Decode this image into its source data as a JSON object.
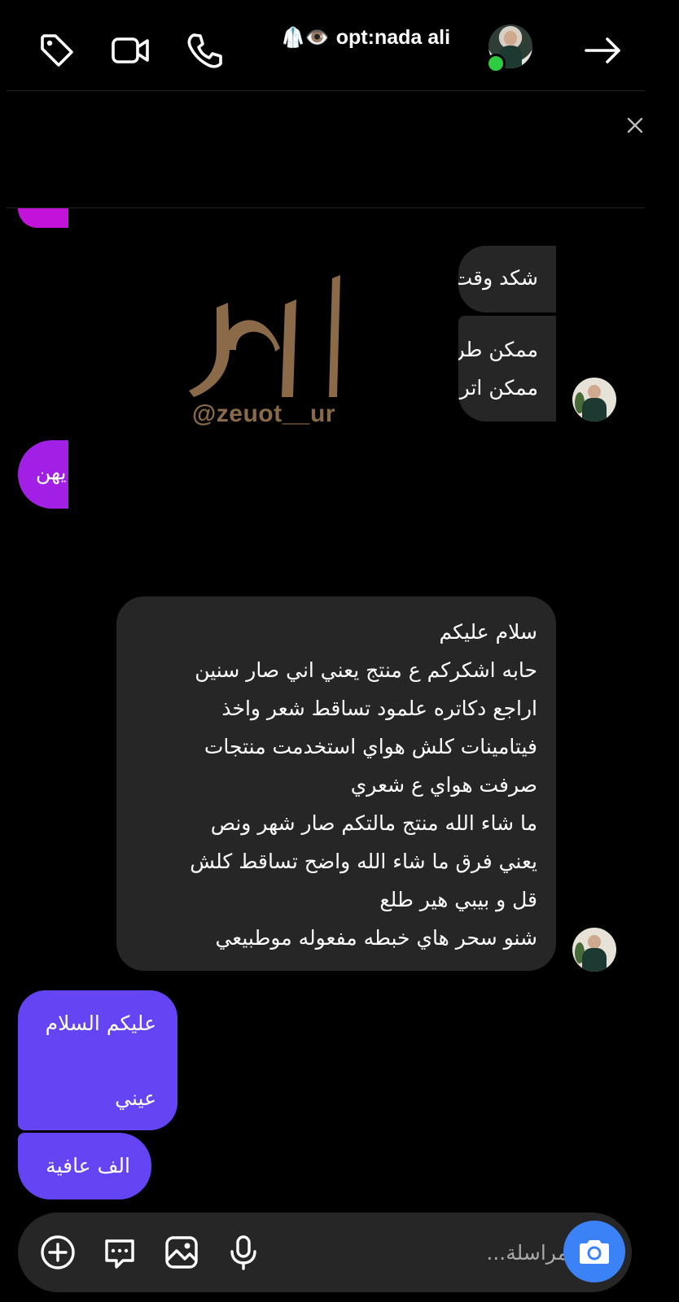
{
  "header": {
    "title": "opt:nada ali",
    "title_emojis": "🥼👁️",
    "icons": [
      "tag-icon",
      "video-call-icon",
      "phone-icon",
      "arrow-right-icon"
    ],
    "online": true
  },
  "pinned": {
    "close_icon": "close-icon"
  },
  "watermark": {
    "handle": "@zeuot__ur"
  },
  "messages": [
    {
      "side": "out",
      "color": "#c312d9",
      "text": ""
    },
    {
      "side": "in",
      "lines": [
        "شكد وقت"
      ]
    },
    {
      "side": "in",
      "lines": [
        "ممكن طريقة",
        "ممكن اترك"
      ]
    },
    {
      "side": "out",
      "color": "#a21fe6",
      "text": "يهن"
    },
    {
      "side": "in",
      "lines": [
        "سلام عليكم",
        "حابه اشكركم ع منتج يعني اني صار سنين",
        "اراجع دكاتره علمود تساقط شعر واخذ",
        "فيتامينات كلش هواي استخدمت منتجات",
        "صرفت هواي ع شعري",
        "ما شاء الله منتج مالتكم صار شهر ونص",
        "يعني فرق ما شاء الله واضح تساقط كلش",
        "قل و بيبي هير طلع",
        "شنو سحر هاي خبطه مفعوله موطبيعي"
      ]
    },
    {
      "side": "out",
      "color": "#6544f4",
      "lines": [
        "عليكم السلام",
        "",
        "عيني"
      ]
    },
    {
      "side": "out",
      "color": "#6544f4",
      "lines": [
        "الف عافية"
      ]
    }
  ],
  "composer": {
    "placeholder": "مراسلة...",
    "value": "",
    "icons": [
      "add-icon",
      "sticker-icon",
      "gallery-icon",
      "microphone-icon",
      "camera-icon"
    ],
    "accent": "#3b82f6"
  }
}
